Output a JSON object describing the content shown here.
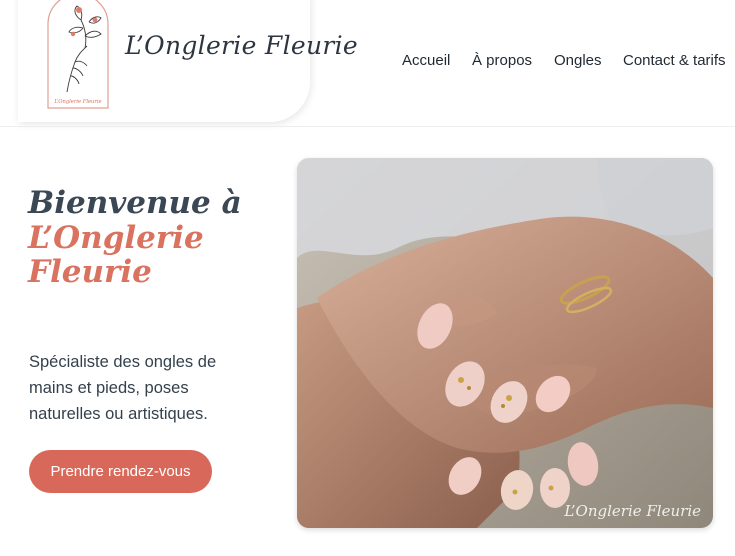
{
  "header": {
    "brand_name": "L’Onglerie Fleurie",
    "logo_caption": "L’Onglerie Fleurie",
    "nav": [
      {
        "label": "Accueil"
      },
      {
        "label": "À propos"
      },
      {
        "label": "Ongles"
      },
      {
        "label": "Contact & tarifs"
      }
    ]
  },
  "hero": {
    "title_line1": "Bienvenue à",
    "title_line2": "L’Onglerie",
    "title_line3": "Fleurie",
    "description": "Spécialiste des ongles de mains et pieds, poses naturelles ou artistiques.",
    "cta_label": "Prendre rendez-vous",
    "photo_watermark": "L’Onglerie Fleurie"
  },
  "colors": {
    "accent": "#d8695a",
    "text_dark": "#2f3a44"
  },
  "icons": {
    "logo": "flower-hand-logo"
  }
}
